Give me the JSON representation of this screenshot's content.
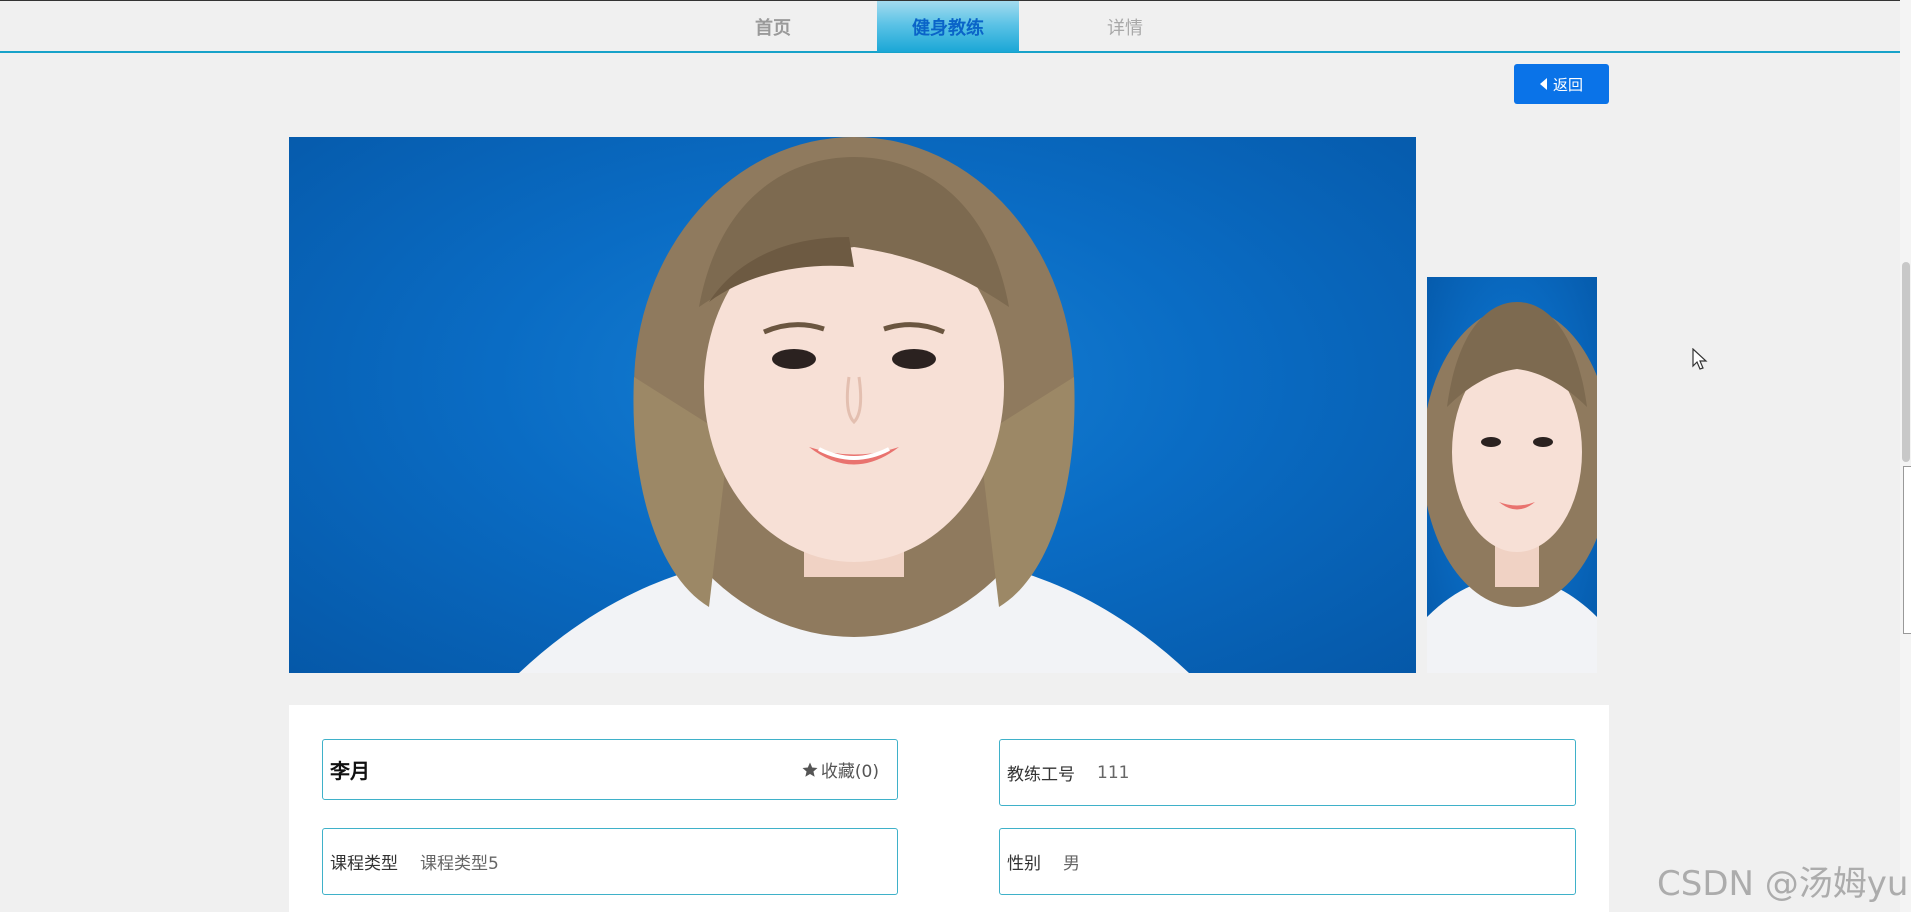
{
  "nav": {
    "items": [
      {
        "label": "首页"
      },
      {
        "label": "健身教练"
      },
      {
        "label": "详情"
      }
    ],
    "active_color": "#0a64c8"
  },
  "back_button": {
    "label": "返回"
  },
  "coach": {
    "name": "李月",
    "favorite_label": "收藏(0)",
    "fields": [
      {
        "label": "教练工号",
        "value": "111"
      },
      {
        "label": "课程类型",
        "value": "课程类型5"
      },
      {
        "label": "性别",
        "value": "男"
      }
    ]
  },
  "colors": {
    "accent": "#17a2c9",
    "button": "#0a73e8",
    "photo_background": "#0a6cc4"
  },
  "watermark": "CSDN @汤姆yu"
}
